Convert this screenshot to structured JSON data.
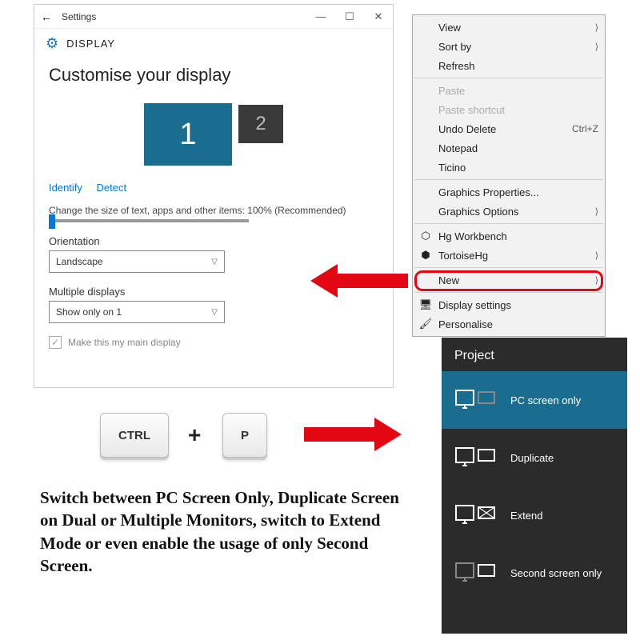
{
  "settings": {
    "window_title": "Settings",
    "section": "DISPLAY",
    "heading": "Customise your display",
    "monitor1": "1",
    "monitor2": "2",
    "identify": "Identify",
    "detect": "Detect",
    "scale_label": "Change the size of text, apps and other items: 100% (Recommended)",
    "orientation_label": "Orientation",
    "orientation_value": "Landscape",
    "multiple_label": "Multiple displays",
    "multiple_value": "Show only on 1",
    "main_display": "Make this my main display"
  },
  "context_menu": {
    "items": [
      {
        "label": "View",
        "arrow": true
      },
      {
        "label": "Sort by",
        "arrow": true
      },
      {
        "label": "Refresh"
      },
      {
        "sep": true
      },
      {
        "label": "Paste",
        "disabled": true
      },
      {
        "label": "Paste shortcut",
        "disabled": true
      },
      {
        "label": "Undo Delete",
        "shortcut": "Ctrl+Z"
      },
      {
        "label": "Notepad"
      },
      {
        "label": "Ticino"
      },
      {
        "sep": true
      },
      {
        "label": "Graphics Properties..."
      },
      {
        "label": "Graphics Options",
        "arrow": true
      },
      {
        "sep": true
      },
      {
        "label": "Hg Workbench",
        "icon": "hg"
      },
      {
        "label": "TortoiseHg",
        "icon": "thg",
        "arrow": true
      },
      {
        "sep": true
      },
      {
        "label": "New",
        "arrow": true
      },
      {
        "sep": true
      },
      {
        "label": "Display settings",
        "icon": "disp"
      },
      {
        "label": "Personalise",
        "icon": "pers"
      }
    ]
  },
  "keys": {
    "ctrl": "CTRL",
    "p": "P"
  },
  "project": {
    "title": "Project",
    "items": [
      {
        "label": "PC screen only",
        "selected": true
      },
      {
        "label": "Duplicate"
      },
      {
        "label": "Extend"
      },
      {
        "label": "Second screen only"
      }
    ]
  },
  "caption": "Switch between PC Screen Only, Duplicate Screen on Dual or Multiple Monitors, switch to Extend Mode or even enable the usage of only Second Screen."
}
